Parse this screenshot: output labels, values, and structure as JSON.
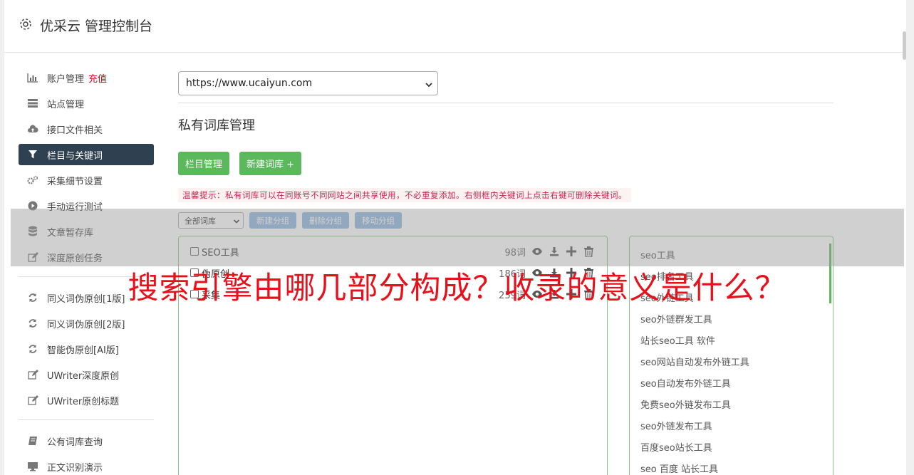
{
  "app": {
    "title": "优采云 管理控制台"
  },
  "sidebar": {
    "group1": [
      {
        "label": "账户管理",
        "badge": "充值",
        "icon": "bar-chart-icon"
      },
      {
        "label": "站点管理",
        "icon": "server-icon"
      },
      {
        "label": "接口文件相关",
        "icon": "cloud-upload-icon"
      },
      {
        "label": "栏目与关键词",
        "icon": "filter-icon",
        "active": true
      },
      {
        "label": "采集细节设置",
        "icon": "gears-icon"
      },
      {
        "label": "手动运行测试",
        "icon": "play-circle-icon"
      },
      {
        "label": "文章暂存库",
        "icon": "database-icon"
      },
      {
        "label": "深度原创任务",
        "icon": "edit-icon"
      }
    ],
    "group2": [
      {
        "label": "同义词伪原创[1版]",
        "icon": "refresh-icon"
      },
      {
        "label": "同义词伪原创[2版]",
        "icon": "refresh-icon"
      },
      {
        "label": "智能伪原创[AI版]",
        "icon": "refresh-icon"
      },
      {
        "label": "UWriter深度原创",
        "icon": "edit-icon"
      },
      {
        "label": "UWriter原创标题",
        "icon": "edit-icon"
      }
    ],
    "group3": [
      {
        "label": "公有词库查询",
        "icon": "book-icon"
      },
      {
        "label": "正文识别演示",
        "icon": "monitor-icon"
      }
    ]
  },
  "main": {
    "site_select": "https://www.ucaiyun.com",
    "page_title": "私有词库管理",
    "btn_columns": "栏目管理",
    "btn_new_lib": "新建词库 +",
    "tip": "温馨提示：私有词库可以在同账号不同网站之间共享使用，不必重复添加。右侧框内关键词上点击右键可删除关键词。",
    "filter_select": "全部词库",
    "btn_new_group": "新建分组",
    "btn_delete_group": "删除分组",
    "btn_move_group": "移动分组",
    "libraries": [
      {
        "name": "SEO工具",
        "count": "98词"
      },
      {
        "name": "伪原创",
        "count": "186词"
      },
      {
        "name": "采集",
        "count": "259词"
      }
    ],
    "keywords": [
      "seo工具",
      "seo排名工具",
      "seo外链工具",
      "seo外链群发工具",
      "站长seo工具 软件",
      "seo网站自动发布外链工具",
      "seo自动发布外链工具",
      "免费seo外链发布工具",
      "seo外链发布工具",
      "百度seo站长工具",
      "seo 百度 站长工具"
    ]
  },
  "overlay": {
    "headline": "搜索引擎由哪几部分构成？收录的意义是什么？"
  },
  "colors": {
    "accent_green": "#5cb85c",
    "active_nav": "#2f4050",
    "headline_red": "#e8101a",
    "badge_red": "#d9001b"
  }
}
